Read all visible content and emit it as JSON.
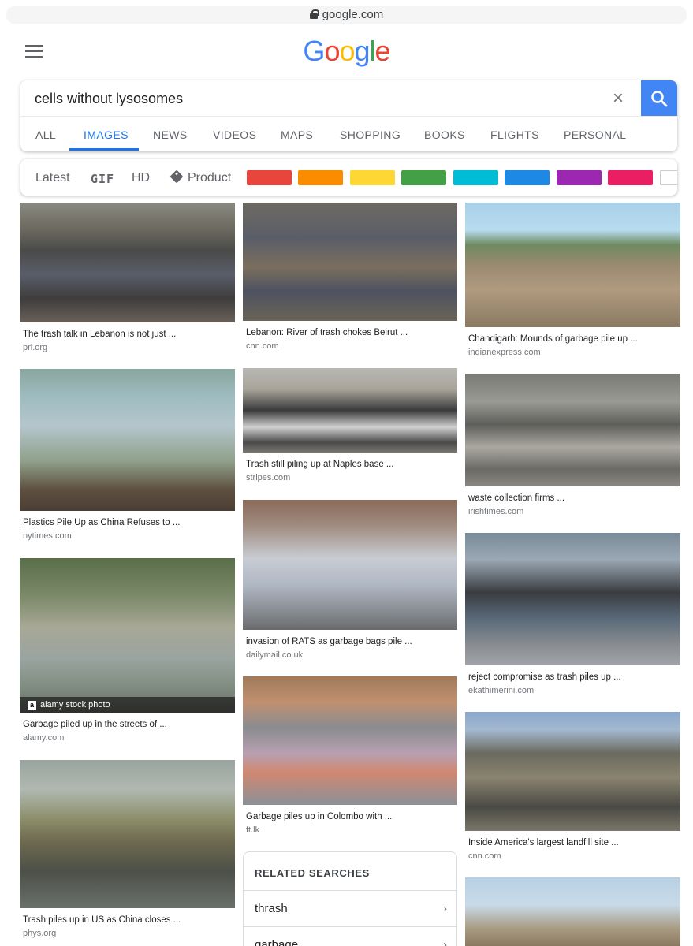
{
  "browser": {
    "url": "google.com"
  },
  "header": {
    "logo_letters": [
      "G",
      "o",
      "o",
      "g",
      "l",
      "e"
    ]
  },
  "search": {
    "query": "cells without lysosomes"
  },
  "tabs": [
    {
      "label": "ALL"
    },
    {
      "label": "IMAGES",
      "active": true
    },
    {
      "label": "NEWS"
    },
    {
      "label": "VIDEOS"
    },
    {
      "label": "MAPS"
    },
    {
      "label": "SHOPPING"
    },
    {
      "label": "BOOKS"
    },
    {
      "label": "FLIGHTS"
    },
    {
      "label": "PERSONAL"
    }
  ],
  "filters": {
    "latest": "Latest",
    "gif": "GIF",
    "hd": "HD",
    "product": "Product",
    "colors": [
      "#e8453c",
      "#fb8c00",
      "#fdd835",
      "#43a047",
      "#00bcd4",
      "#1e88e5",
      "#9c27b0",
      "#e91e63",
      "#ffffff"
    ]
  },
  "results": {
    "col1": [
      {
        "caption": "The trash talk in Lebanon is not just ...",
        "source": "pri.org"
      },
      {
        "caption": "Plastics Pile Up as China Refuses to ...",
        "source": "nytimes.com"
      },
      {
        "caption": "Garbage piled up in the streets of ...",
        "source": "alamy.com",
        "watermark": "alamy stock photo"
      },
      {
        "caption": "Trash piles up in US as China closes ...",
        "source": "phys.org"
      }
    ],
    "col2": [
      {
        "caption": "Lebanon: River of trash chokes Beirut ...",
        "source": "cnn.com"
      },
      {
        "caption": "Trash still piling up at Naples base ...",
        "source": "stripes.com"
      },
      {
        "caption": "invasion of RATS as garbage bags pile ...",
        "source": "dailymail.co.uk"
      },
      {
        "caption": "Garbage piles up in Colombo with ...",
        "source": "ft.lk"
      }
    ],
    "col3": [
      {
        "caption": "Chandigarh: Mounds of garbage pile up ...",
        "source": "indianexpress.com"
      },
      {
        "caption": "waste collection firms ...",
        "source": "irishtimes.com"
      },
      {
        "caption": "reject compromise as trash piles up ...",
        "source": "ekathimerini.com"
      },
      {
        "caption": "Inside America's largest landfill site ...",
        "source": "cnn.com"
      }
    ]
  },
  "related": {
    "title": "RELATED SEARCHES",
    "items": [
      {
        "label": "thrash"
      },
      {
        "label": "garbage"
      }
    ]
  }
}
